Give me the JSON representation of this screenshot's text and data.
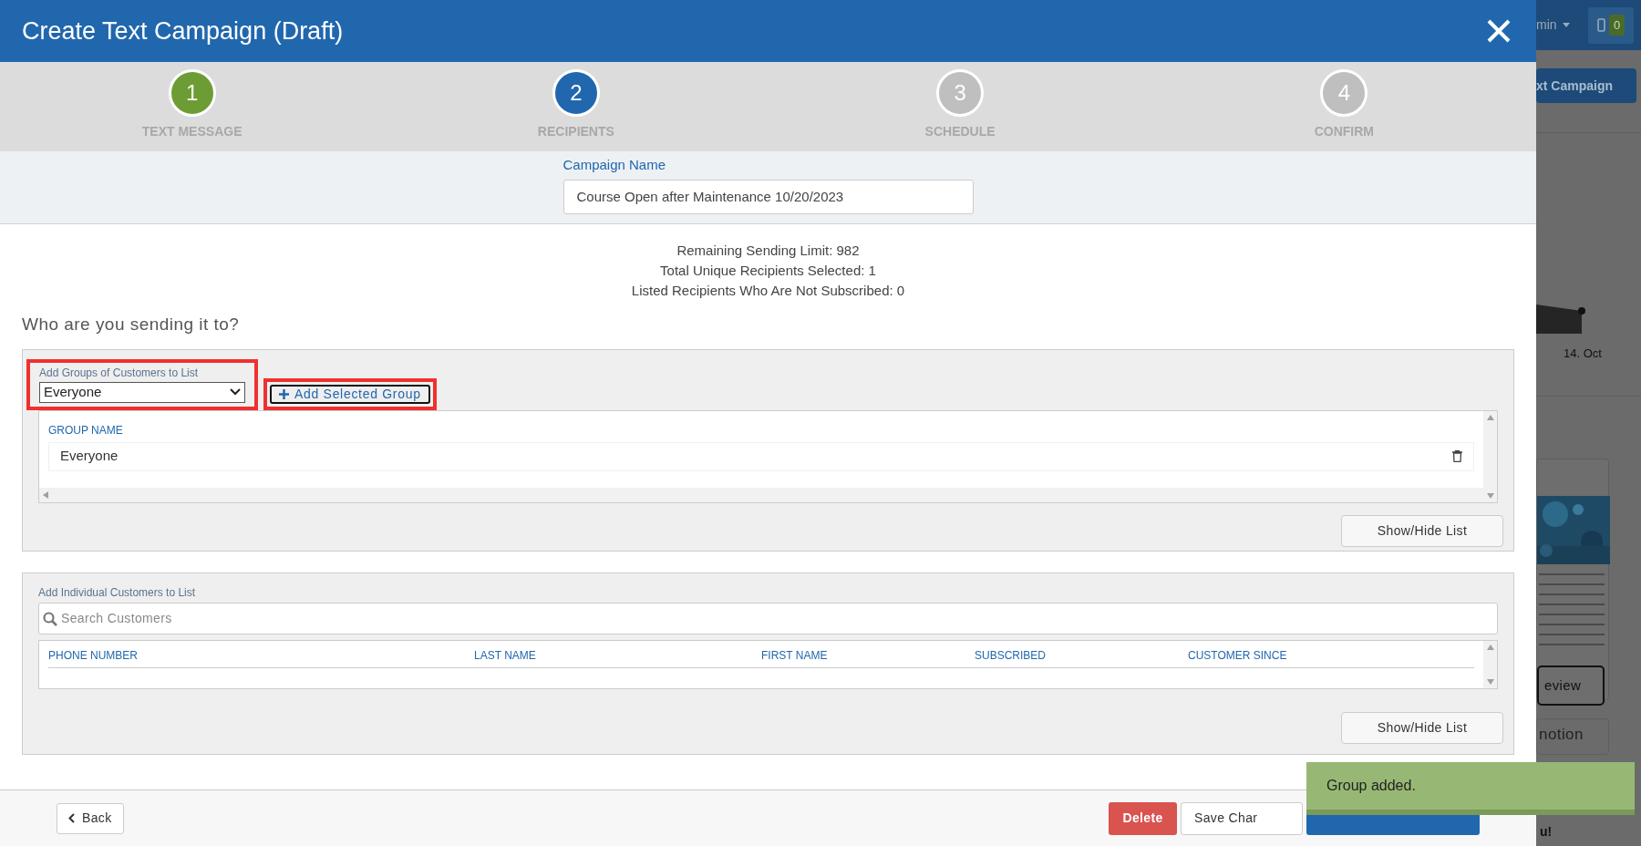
{
  "window": {
    "title": "Create Text Campaign (Draft)"
  },
  "steps": [
    {
      "number": "1",
      "label": "TEXT MESSAGE",
      "completed": true,
      "selected": false
    },
    {
      "number": "2",
      "label": "RECIPIENTS",
      "completed": false,
      "selected": true
    },
    {
      "number": "3",
      "label": "SCHEDULE",
      "completed": false,
      "selected": false
    },
    {
      "number": "4",
      "label": "CONFIRM",
      "completed": false,
      "selected": false
    }
  ],
  "campaign_name": {
    "label": "Campaign Name",
    "value": "Course Open after Maintenance 10/20/2023"
  },
  "stats": [
    "Remaining Sending Limit: 982",
    "Total Unique Recipients Selected: 1",
    "Listed Recipients Who Are Not Subscribed: 0"
  ],
  "question": "Who are you sending it to?",
  "groups_panel": {
    "label": "Add Groups of Customers to List",
    "select_value": "Everyone",
    "add_button": "Add Selected Group",
    "highlighted": true,
    "columns": [
      "GROUP NAME"
    ],
    "rows": [
      {
        "name": "Everyone"
      }
    ],
    "toggle_button": "Show/Hide List"
  },
  "individual_panel": {
    "label": "Add Individual Customers to List",
    "search": {
      "placeholder": "Search Customers"
    },
    "columns": [
      "PHONE NUMBER",
      "LAST NAME",
      "FIRST NAME",
      "SUBSCRIBED",
      "CUSTOMER SINCE"
    ],
    "toggle_button": "Show/Hide List"
  },
  "footer": {
    "back": "Back",
    "delete": "Delete",
    "save": "Save Char"
  },
  "toast": "Group added.",
  "background": {
    "user_menu": "min",
    "phone_count": "0",
    "campaign_button": "xt Campaign",
    "chart_label": "14. Oct",
    "preview_button": "eview",
    "card_title": "notion",
    "footer_text": "u!"
  }
}
